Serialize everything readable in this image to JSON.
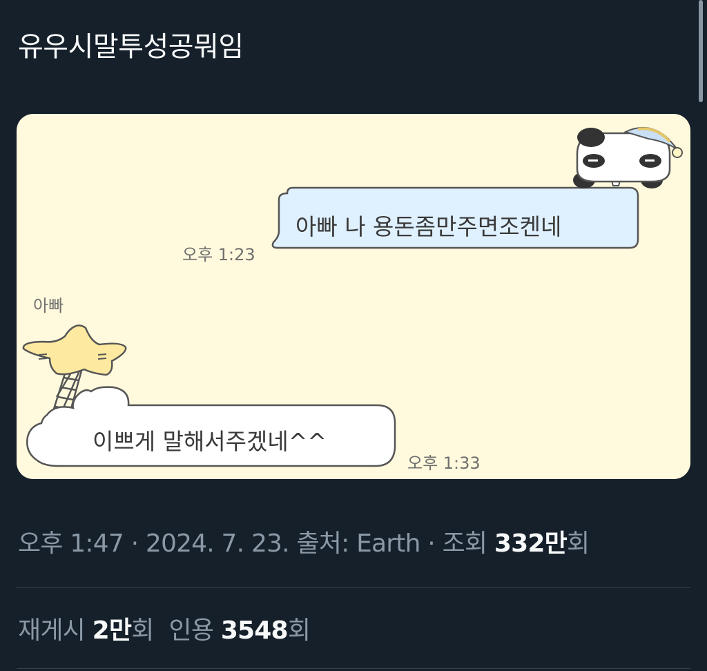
{
  "tweet": {
    "text": "유우시말투성공뭐임"
  },
  "chat": {
    "sent_message": "아빠 나 용돈좀만주면조켄네",
    "sent_time": "오후 1:23",
    "sender_name": "아빠",
    "received_message": "이쁘게 말해서주겠네^^",
    "received_time": "오후 1:33"
  },
  "meta": {
    "time_date": "오후 1:47 · 2024. 7. 23. ",
    "source_label": "출처: ",
    "source_value": "Earth",
    "separator": " · ",
    "views_label": "조회 ",
    "views_count": "332만",
    "views_unit": "회"
  },
  "stats": {
    "reposts_label": "재게시 ",
    "reposts_count": "2만",
    "reposts_unit": "회",
    "quotes_label": "인용 ",
    "quotes_count": "3548",
    "quotes_unit": "회"
  },
  "colors": {
    "background": "#15202b",
    "chat_background": "#fff9dd",
    "sent_bubble": "#dff0ff",
    "star": "#fdeaa0"
  },
  "icons": [
    "panda-sleeping-icon",
    "star-icon",
    "ladder-icon",
    "cloud-bubble-icon"
  ]
}
